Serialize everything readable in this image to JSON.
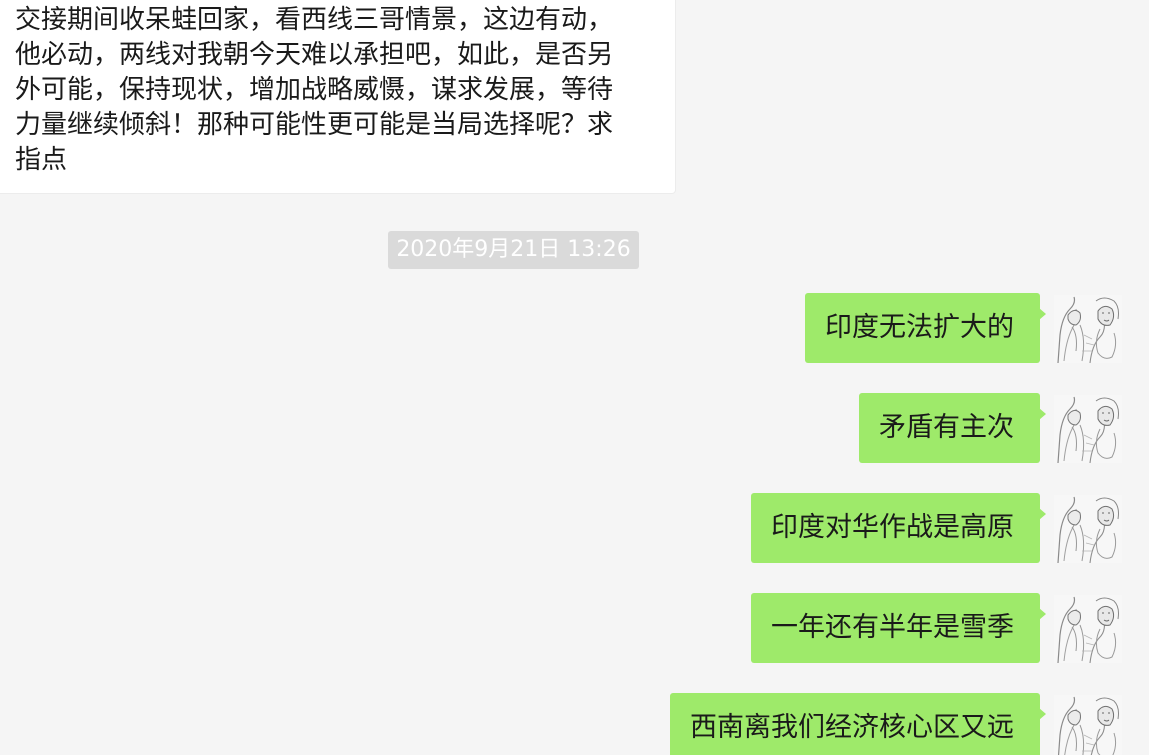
{
  "chat": {
    "incoming": {
      "lines": [
        "交接期间收呆蛙回家，看西线三哥情景，这边有动，",
        "他必动，两线对我朝今天难以承担吧，如此，是否另",
        "外可能，保持现状，增加战略威慑，谋求发展，等待",
        "力量继续倾斜！那种可能性更可能是当局选择呢？求",
        "指点"
      ]
    },
    "timestamp": "2020年9月21日 13:26",
    "outgoing": [
      {
        "text": "印度无法扩大的",
        "avatar_icon": "sketch-portrait-avatar"
      },
      {
        "text": "矛盾有主次",
        "avatar_icon": "sketch-portrait-avatar"
      },
      {
        "text": "印度对华作战是高原",
        "avatar_icon": "sketch-portrait-avatar"
      },
      {
        "text": "一年还有半年是雪季",
        "avatar_icon": "sketch-portrait-avatar"
      },
      {
        "text": "西南离我们经济核心区又远",
        "avatar_icon": "sketch-portrait-avatar"
      }
    ],
    "colors": {
      "background": "#f5f5f5",
      "outgoing_bubble": "#9eea6a",
      "incoming_bubble": "#ffffff",
      "timestamp_bg": "#dadada"
    }
  }
}
